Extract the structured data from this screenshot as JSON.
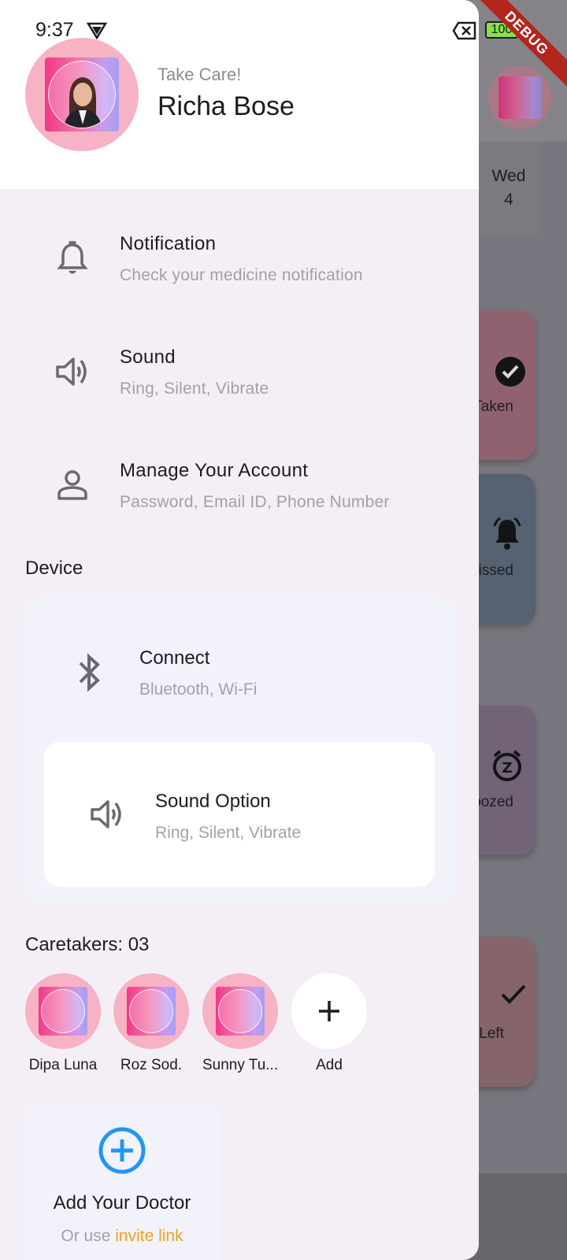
{
  "status_bar": {
    "time": "9:37",
    "battery": "100"
  },
  "debug_banner": "DEBUG",
  "background": {
    "day_name": "Wed",
    "day_number": "4",
    "cards": [
      {
        "label": "Taken",
        "color": "#a8707e",
        "icon": "check-circle-icon"
      },
      {
        "label": "issed",
        "color": "#5f6f82",
        "icon": "alarm-icon"
      },
      {
        "label": "oozed",
        "color": "#83718a",
        "icon": "snooze-icon"
      },
      {
        "label": "Left",
        "color": "#9a7278",
        "icon": "check-icon"
      }
    ]
  },
  "profile": {
    "greeting": "Take Care!",
    "name": "Richa Bose"
  },
  "settings": [
    {
      "icon": "bell-icon",
      "title": "Notification",
      "subtitle": "Check your medicine notification"
    },
    {
      "icon": "volume-icon",
      "title": "Sound",
      "subtitle": "Ring, Silent, Vibrate"
    },
    {
      "icon": "person-icon",
      "title": "Manage Your Account",
      "subtitle": "Password, Email ID, Phone Number"
    }
  ],
  "device": {
    "section_title": "Device",
    "connect": {
      "icon": "bluetooth-icon",
      "title": "Connect",
      "subtitle": "Bluetooth, Wi-Fi"
    },
    "sound_option": {
      "icon": "volume-icon",
      "title": "Sound Option",
      "subtitle": "Ring, Silent, Vibrate"
    }
  },
  "caretakers": {
    "title": "Caretakers: 03",
    "people": [
      {
        "name": "Dipa Luna"
      },
      {
        "name": "Roz Sod."
      },
      {
        "name": "Sunny Tu..."
      }
    ],
    "add_label": "Add"
  },
  "doctor": {
    "title": "Add Your Doctor",
    "prefix": "Or use ",
    "link": "invite link"
  },
  "colors": {
    "drawer_bg": "#f4eff6",
    "avatar_bg": "#f7b2c4",
    "accent_blue": "#2196f3",
    "link_orange": "#f2a01c"
  }
}
